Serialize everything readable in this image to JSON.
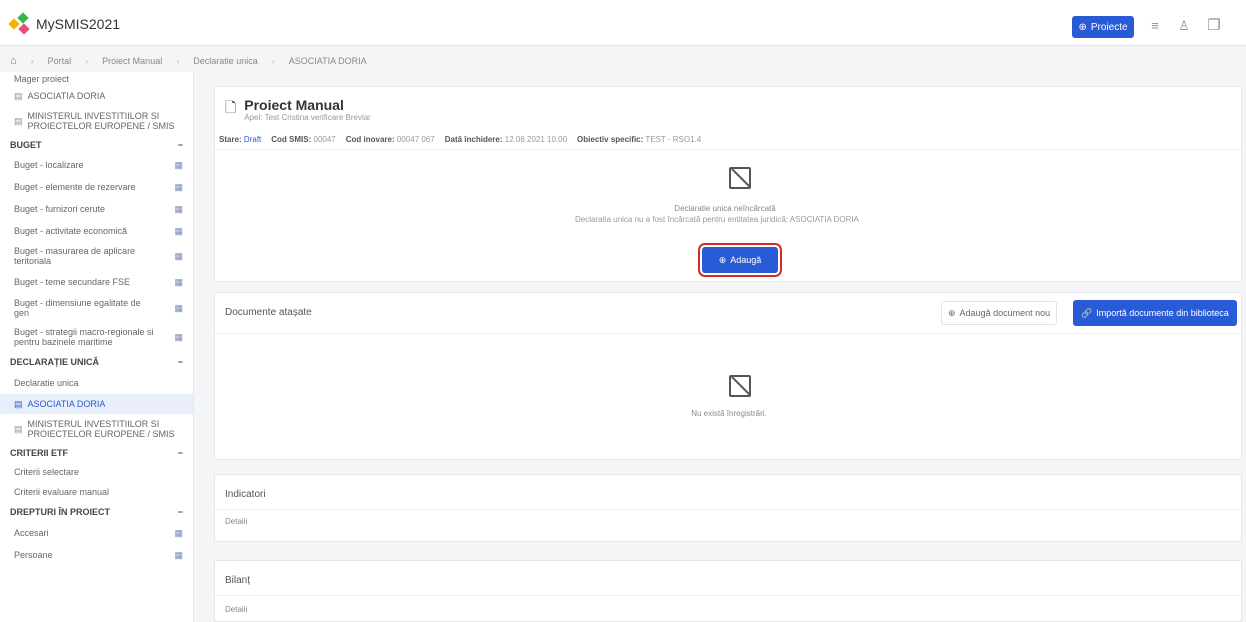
{
  "app": {
    "title": "MySMIS2021"
  },
  "header": {
    "proiecte_label": "Proiecte"
  },
  "breadcrumb": [
    "Portal",
    "Proiect Manual",
    "Declaratie unica",
    "ASOCIATIA DORIA"
  ],
  "sidebar": {
    "top_items": [
      {
        "label": "Mager proiect",
        "icon": "document-icon"
      },
      {
        "label": "ASOCIATIA DORIA",
        "icon": "document-icon"
      },
      {
        "label": "MINISTERUL INVESTITIILOR SI PROIECTELOR EUROPENE / SMIS",
        "icon": "document-icon"
      }
    ],
    "sections": [
      {
        "title": "BUGET",
        "items": [
          {
            "label": "Buget - localizare"
          },
          {
            "label": "Buget - elemente de rezervare"
          },
          {
            "label": "Buget - furnizori cerute"
          },
          {
            "label": "Buget - activitate economică"
          },
          {
            "label": "Buget - masurarea de aplicare teritoriala"
          },
          {
            "label": "Buget - teme secundare FSE"
          },
          {
            "label": "Buget - dimensiune egalitate de gen"
          },
          {
            "label": "Buget - strategii macro-regionale si pentru bazinele maritime"
          }
        ]
      },
      {
        "title": "DECLARAȚIE UNICĂ",
        "items": [
          {
            "label": "Declaratie unica"
          },
          {
            "label": "ASOCIATIA DORIA",
            "active": true
          },
          {
            "label": "MINISTERUL INVESTITIILOR SI PROIECTELOR EUROPENE / SMIS"
          }
        ]
      },
      {
        "title": "CRITERII ETF",
        "items": [
          {
            "label": "Criterii selectare"
          },
          {
            "label": "Criterii evaluare manual"
          }
        ]
      },
      {
        "title": "DREPTURI ÎN PROIECT",
        "items": [
          {
            "label": "Accesari"
          },
          {
            "label": "Persoane"
          }
        ]
      }
    ]
  },
  "project": {
    "title": "Proiect Manual",
    "subtitle": "Apel: Test Cristina verificare Breviar",
    "meta": {
      "stare_label": "Stare:",
      "stare_value": "Draft",
      "cod_smis_label": "Cod SMIS:",
      "cod_smis_value": "00047",
      "cod_inovare_label": "Cod inovare:",
      "cod_inovare_value": "00047 067",
      "data_inchidere_label": "Dată închidere:",
      "data_inchidere_value": "12.06.2021 10:00",
      "obiectiv_label": "Obiectiv specific:",
      "obiectiv_value": "TEST - RSO1.4"
    }
  },
  "declaration": {
    "title": "Declaratie unica neîncărcată",
    "description": "Declaratia unica nu a fost încărcată pentru entitatea juridică: ASOCIATIA DORIA",
    "add_label": "Adaugă"
  },
  "documents": {
    "title": "Documente atașate",
    "add_new_label": "Adaugă document nou",
    "import_label": "Importă documente din biblioteca",
    "empty_text": "Nu există înregistrări."
  },
  "indicators": {
    "title": "Indicatori",
    "row_label": "Detalii"
  },
  "other": {
    "title": "Bilanț",
    "row_label": "Detalii"
  }
}
